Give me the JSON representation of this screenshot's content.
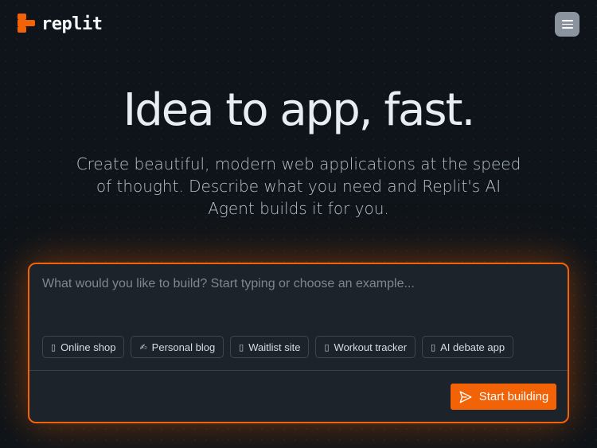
{
  "brand": {
    "name": "replit",
    "logo_icon": "replit-logo-icon",
    "accent_color": "#f26207"
  },
  "header": {
    "menu_icon": "hamburger-menu-icon"
  },
  "hero": {
    "title": "Idea to app, fast.",
    "subtitle": "Create beautiful, modern web applications at the speed of thought. Describe what you need and Replit's AI Agent builds it for you."
  },
  "prompt": {
    "value": "",
    "placeholder": "What would you like to build? Start typing or choose an example...",
    "examples": [
      {
        "icon": "cart-icon",
        "glyph": "▯",
        "label": "Online shop"
      },
      {
        "icon": "pen-icon",
        "glyph": "✍",
        "label": "Personal blog"
      },
      {
        "icon": "list-icon",
        "glyph": "▯",
        "label": "Waitlist site"
      },
      {
        "icon": "dumbbell-icon",
        "glyph": "▯",
        "label": "Workout tracker"
      },
      {
        "icon": "chat-icon",
        "glyph": "▯",
        "label": "AI debate app"
      }
    ],
    "submit_label": "Start building",
    "submit_icon": "send-icon"
  }
}
